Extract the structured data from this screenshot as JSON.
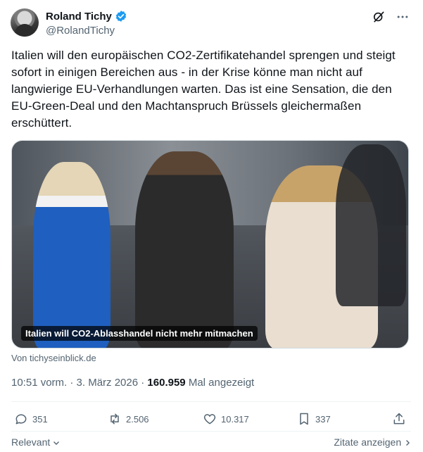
{
  "author": {
    "name": "Roland Tichy",
    "handle": "@RolandTichy"
  },
  "tweet": {
    "text": "Italien will den europäischen CO2-Zertifikatehandel sprengen und steigt sofort in einigen Bereichen  aus - in der Krise könne man nicht auf langwierige EU-Verhandlungen warten. Das ist eine Sensation, die den EU-Green-Deal und den Machtanspruch Brüssels gleichermaßen erschüttert."
  },
  "card": {
    "caption": "Italien will CO2-Ablasshandel nicht mehr mitmachen",
    "source": "Von tichyseinblick.de"
  },
  "meta": {
    "time": "10:51 vorm. · 3. März 2026 · ",
    "views": "160.959",
    "views_label": " Mal angezeigt"
  },
  "actions": {
    "replies": "351",
    "reposts": "2.506",
    "likes": "10.317",
    "bookmarks": "337"
  },
  "footer": {
    "left": "Relevant",
    "right": "Zitate anzeigen"
  },
  "colors": {
    "verified": "#1d9bf0",
    "text": "#0f1419",
    "muted": "#536471"
  },
  "icons": [
    "verified-badge-icon",
    "grok-icon",
    "more-icon",
    "reply-icon",
    "repost-icon",
    "like-icon",
    "bookmark-icon",
    "share-icon",
    "chevron-down-icon",
    "chevron-right-icon"
  ]
}
